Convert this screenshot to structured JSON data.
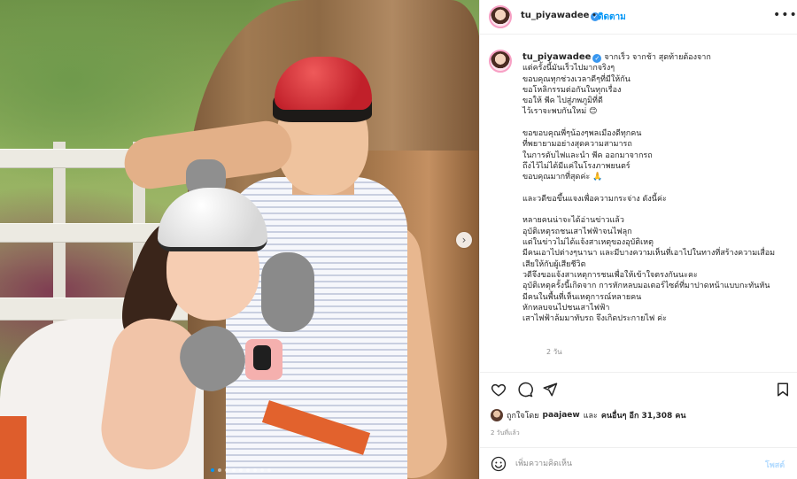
{
  "header": {
    "username": "tu_piyawadee",
    "separator": "•",
    "follow_label": "ติดตาม",
    "more_icon": "more-horizontal-icon"
  },
  "caption": {
    "username": "tu_piyawadee",
    "lines": [
      "จากเร็ว จากช้า สุดท้ายต้องจาก",
      "แต่ครั้งนี้มันเร็วไปมากจริงๆ",
      "ขอบคุณทุกช่วงเวลาดีๆที่มีให้กัน",
      "ขอโหลิกรรมต่อกันในทุกเรื่อง",
      "ขอให้ พีค ไปสู่ภพภูมิที่ดี",
      "ไว้เราจะพบกันใหม่ 😊",
      "",
      "ขอขอบคุณพี่ๆน้องๆพลเมืองดีทุกคน",
      "ที่พยายามอย่างสุดความสามารถ",
      "ในการดับไฟและนำ พีค ออกมาจากรถ",
      "ถึงไว้ไม่ได้มีแค่ในโรงภาพยนตร์",
      "ขอบคุณมากที่สุดค่ะ 🙏",
      "",
      "และวดีขอขึ้นแจงเพื่อความกระจ่าง ดังนี้ค่ะ",
      "",
      "หลายคนน่าจะได้อ่านข่าวแล้ว",
      "อุบัติเหตุรถชนเสาไฟฟ้าจนไฟลุก",
      "แต่ในข่าวไม่ได้แจ้งสาเหตุของอุบัติเหตุ",
      "มีคนเอาไปต่างๆนานา และมีบางความเห็นที่เอาไปในทางที่สร้างความเสื่อม",
      "เสียให้กับผู้เสียชีวิต",
      "วดีจึงขอแจ้งสาเหตุการชนเพื่อให้เข้าใจตรงกันนะคะ",
      "อุบัติเหตุครั้งนี้เกิดจาก การหักหลบมอเตอร์ไซด์ที่มาปาดหน้าแบบกะทันหัน",
      "มีคนในพื้นที่เห็นเหตุการณ์หลายคน",
      "หักหลบจนไปชนเสาไฟฟ้า",
      "เสาไฟฟ้าล้มมาทับรถ จึงเกิดประกายไฟ ค่ะ"
    ],
    "age": "2 วัน"
  },
  "actions": {
    "like_icon": "heart-icon",
    "comment_icon": "comment-icon",
    "share_icon": "paper-plane-icon",
    "save_icon": "bookmark-icon"
  },
  "likes": {
    "prefix": "ถูกใจโดย",
    "user": "paajaew",
    "middle": "และ",
    "others": "คนอื่นๆ อีก 31,308 คน"
  },
  "posted_time": "2 วันที่แล้ว",
  "comment": {
    "placeholder": "เพิ่มความคิดเห็น",
    "post_label": "โพสต์",
    "emoji_icon": "smiley-icon"
  },
  "carousel": {
    "next_icon": "chevron-right-icon",
    "dot_count": 9,
    "active_index": 0
  },
  "colors": {
    "link_blue": "#0095f6",
    "verified_blue": "#3897f0",
    "muted": "#8e8e8e",
    "post_disabled": "#b3dbff"
  }
}
